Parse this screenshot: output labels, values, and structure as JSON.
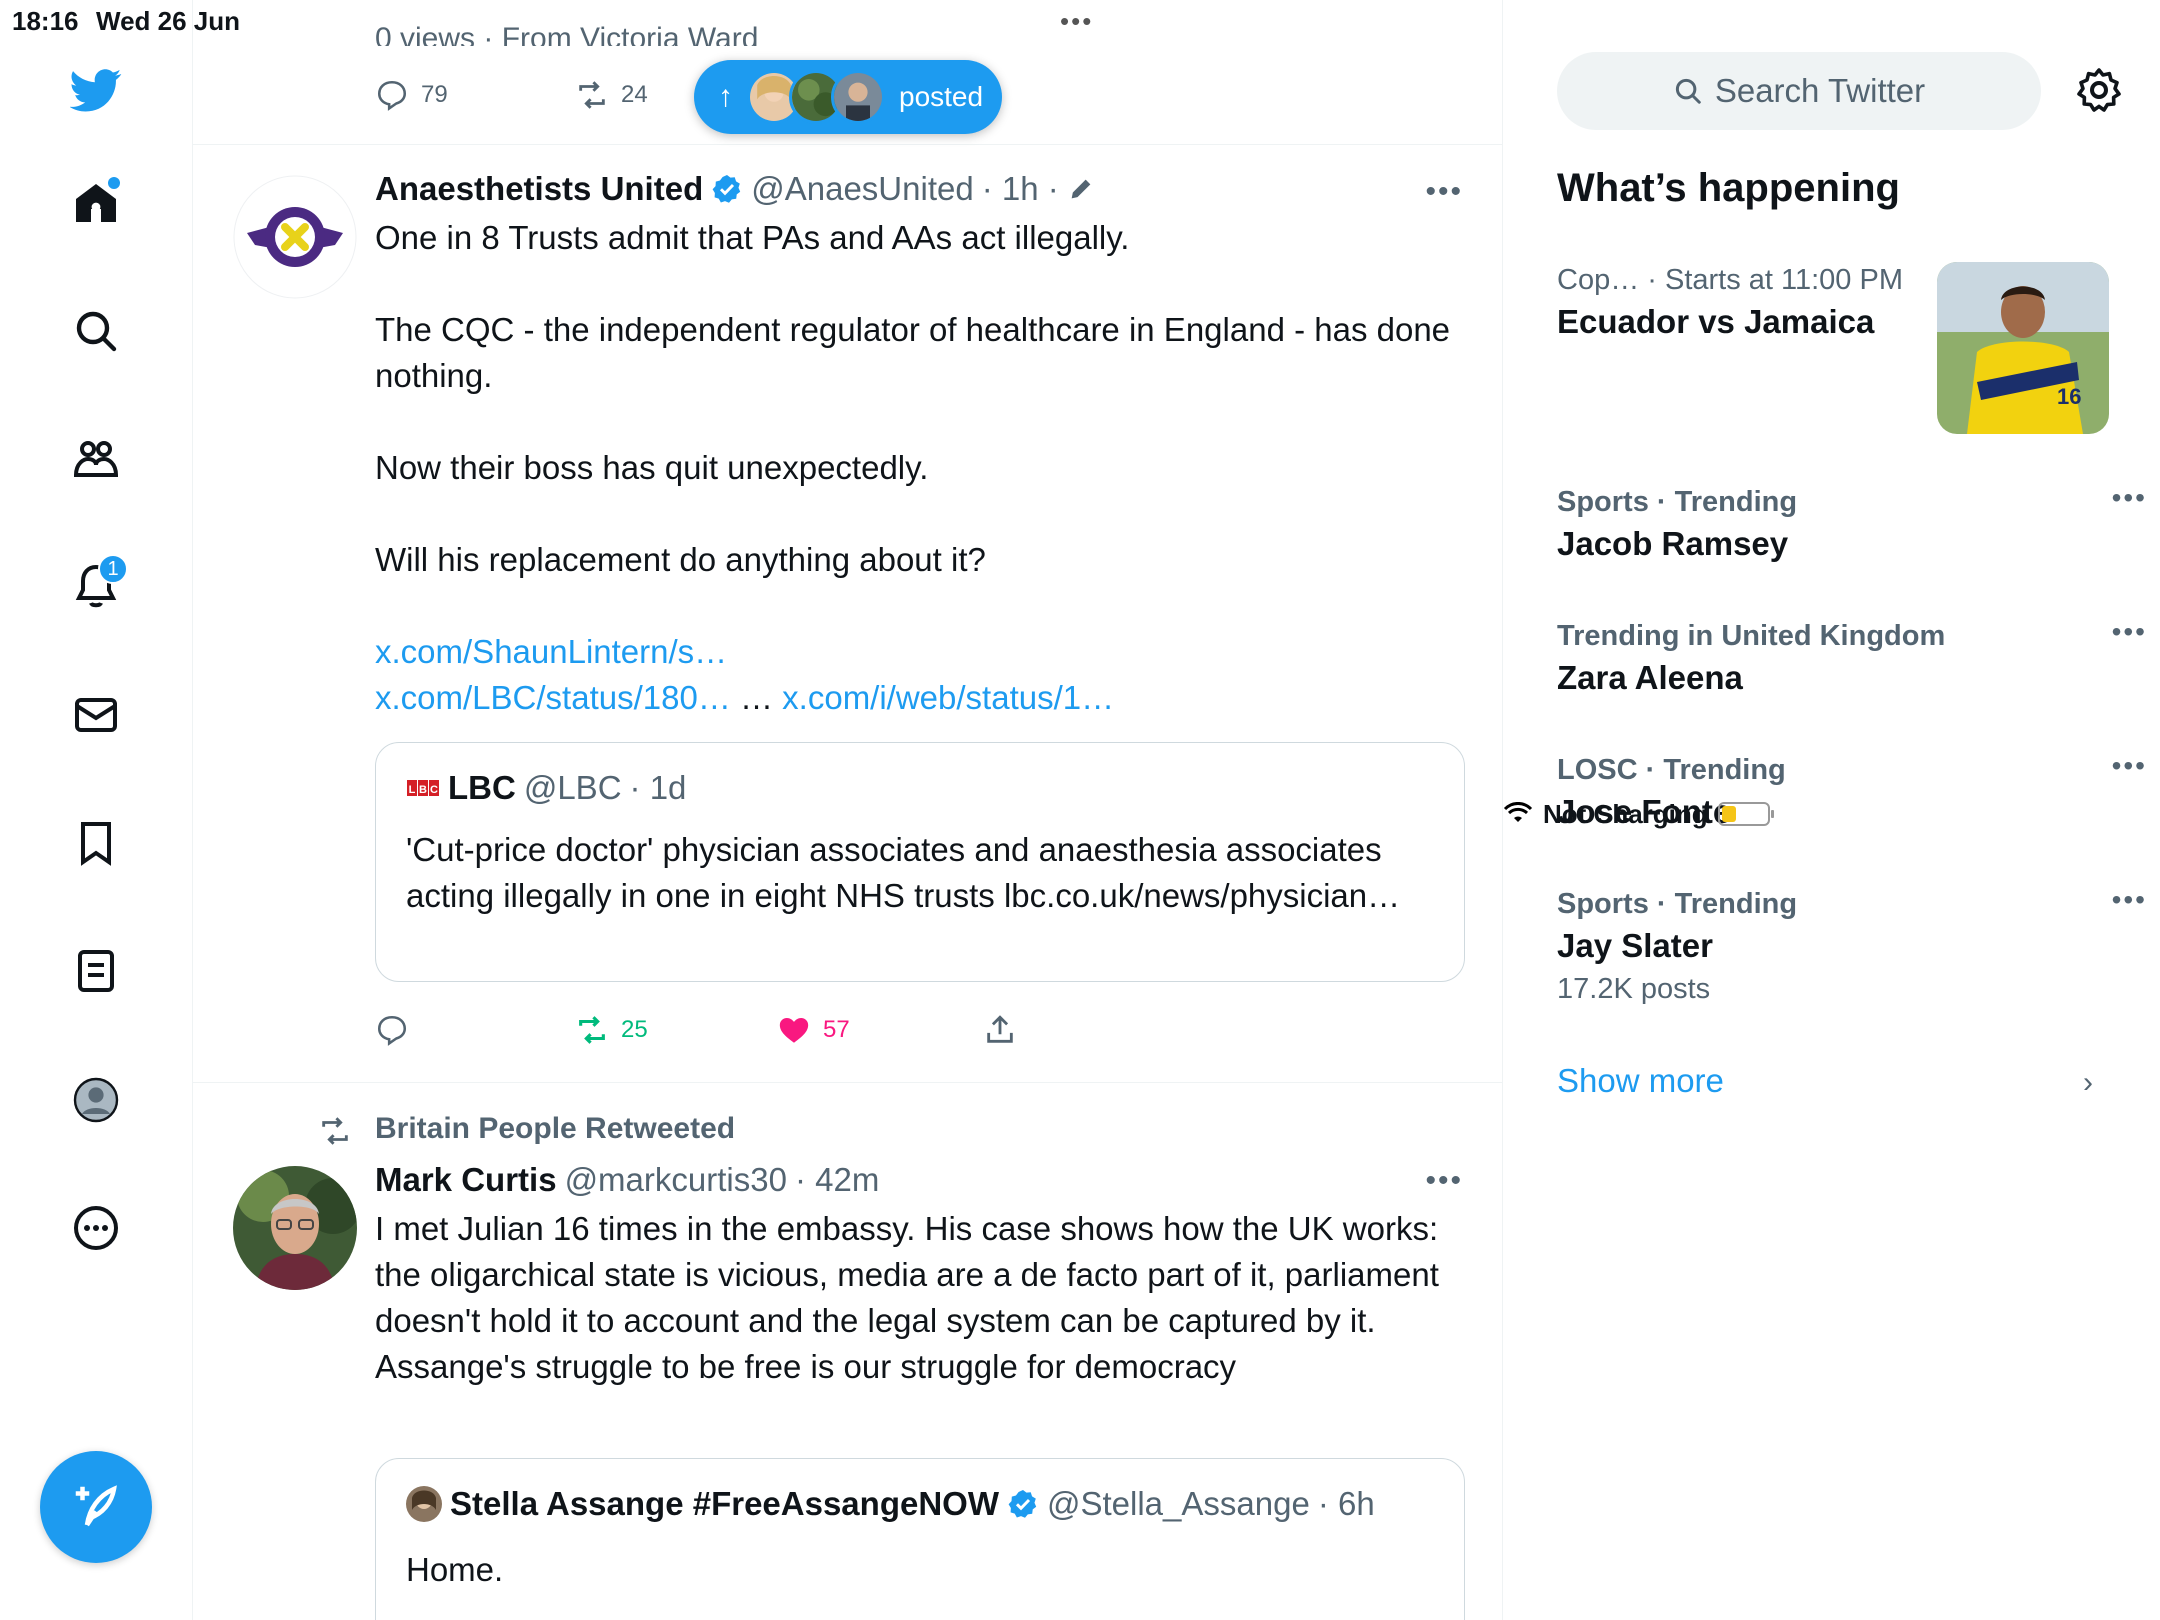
{
  "status_bar": {
    "time": "18:16",
    "date": "Wed 26 Jun",
    "battery_text": "Not Charging"
  },
  "nav": {
    "notifications_badge": "1"
  },
  "prev_tweet": {
    "cut_text": "0 views · From Victoria Ward",
    "reply_count": "79",
    "retweet_count": "24"
  },
  "new_posts_pill": {
    "label": "posted"
  },
  "tweet1": {
    "name": "Anaesthetists United",
    "handle": "@AnaesUnited",
    "time": "· 1h ·",
    "paragraphs": [
      "One in 8 Trusts admit that PAs and AAs act illegally.",
      "The CQC - the independent regulator of healthcare in England - has done nothing.",
      "Now their boss has quit unexpectedly.",
      "Will his replacement do anything about it?"
    ],
    "link1": "x.com/ShaunLintern/s…",
    "link2": "x.com/LBC/status/180…",
    "link_sep": " … ",
    "link3": "x.com/i/web/status/1…",
    "quote": {
      "name": "LBC",
      "handle": "@LBC",
      "time": "· 1d",
      "text": "'Cut-price doctor' physician associates and anaesthesia associates acting illegally in one in eight NHS trusts lbc.co.uk/news/physician…"
    },
    "retweets": "25",
    "likes": "57"
  },
  "tweet2": {
    "retweeted_by": "Britain People Retweeted",
    "name": "Mark Curtis",
    "handle": "@markcurtis30",
    "time": "· 42m",
    "text": "I met Julian 16 times in the embassy. His case shows how the UK works: the oligarchical state is vicious, media are a de facto part of it, parliament doesn't hold it to account and the legal system can be captured by it. Assange's struggle to be free is our struggle for democracy",
    "quote": {
      "name": "Stella Assange #FreeAssangeNOW",
      "handle": "@Stella_Assange",
      "time": "· 6h",
      "text": "Home."
    }
  },
  "sidebar": {
    "search_placeholder": "Search Twitter",
    "title": "What’s happening",
    "featured": {
      "meta": "Cop… · Starts at 11:00 PM",
      "topic": "Ecuador vs Jamaica"
    },
    "trends": [
      {
        "meta": "Sports · Trending",
        "topic": "Jacob Ramsey",
        "posts": ""
      },
      {
        "meta": "Trending in United Kingdom",
        "topic": "Zara Aleena",
        "posts": ""
      },
      {
        "meta": "LOSC · Trending",
        "topic": "Jose Fonte",
        "posts": ""
      },
      {
        "meta": "Sports · Trending",
        "topic": "Jay Slater",
        "posts": "17.2K posts"
      }
    ],
    "show_more": "Show more"
  },
  "colors": {
    "accent": "#1d9bf0",
    "like": "#f91880",
    "retweet": "#00ba7c",
    "secondary_text": "#536471"
  }
}
